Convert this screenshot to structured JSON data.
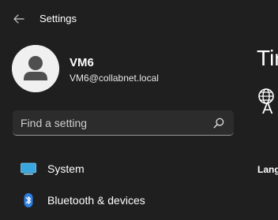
{
  "titlebar": {
    "title": "Settings",
    "back_icon": "back-arrow-icon"
  },
  "profile": {
    "name": "VM6",
    "email": "VM6@collabnet.local"
  },
  "search": {
    "placeholder": "Find a setting",
    "value": "",
    "icon": "search-icon"
  },
  "sidebar": {
    "items": [
      {
        "label": "System",
        "icon": "system-monitor-icon"
      },
      {
        "label": "Bluetooth & devices",
        "icon": "bluetooth-icon"
      }
    ]
  },
  "content": {
    "title": "Tir",
    "sub_letter": "A",
    "section_label": "Lang",
    "icon": "globe-language-icon"
  },
  "colors": {
    "background": "#1f1f1f",
    "search_bg": "#2c2c2c",
    "bluetooth_blue": "#2a7de1",
    "system_blue": "#3aa6e0"
  }
}
